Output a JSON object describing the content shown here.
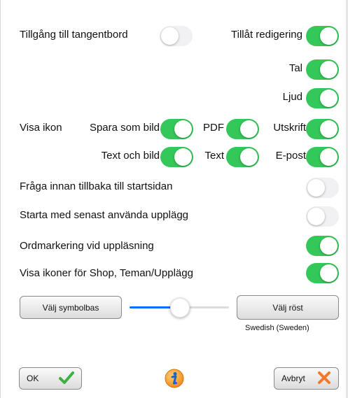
{
  "settings": {
    "keyboard_access": {
      "label": "Tillgång till tangentbord",
      "on": false
    },
    "allow_editing": {
      "label": "Tillåt redigering",
      "on": true
    },
    "speech": {
      "label": "Tal",
      "on": true
    },
    "sound": {
      "label": "Ljud",
      "on": true
    },
    "show_icon_label": "Visa ikon",
    "save_as_image": {
      "label": "Spara som bild",
      "on": true
    },
    "pdf": {
      "label": "PDF",
      "on": true
    },
    "print": {
      "label": "Utskrift",
      "on": true
    },
    "text_and_image": {
      "label": "Text och bild",
      "on": true
    },
    "text": {
      "label": "Text",
      "on": true
    },
    "email": {
      "label": "E-post",
      "on": true
    },
    "ask_before_home": {
      "label": "Fråga innan tillbaka till startsidan",
      "on": false
    },
    "start_latest_layout": {
      "label": "Starta med senast använda upplägg",
      "on": false
    },
    "word_highlight": {
      "label": "Ordmarkering vid uppläsning",
      "on": true
    },
    "show_shop_icons": {
      "label": "Visa ikoner för Shop, Teman/Upplägg",
      "on": true
    }
  },
  "controls": {
    "choose_symbol_base": "Välj symbolbas",
    "choose_voice": "Välj röst",
    "voice_name": "Swedish (Sweden)",
    "speech_rate_fraction": 0.5
  },
  "footer": {
    "ok": "OK",
    "cancel": "Avbryt"
  },
  "colors": {
    "switch_on": "#34c759",
    "switch_off": "#e9e9eb",
    "slider_active": "#0a6cff",
    "ok_check": "#3cb043",
    "cancel_x": "#f07a2a",
    "info": "#f08c1a"
  },
  "icons": [
    "checkmark-icon",
    "close-icon",
    "info-icon"
  ]
}
